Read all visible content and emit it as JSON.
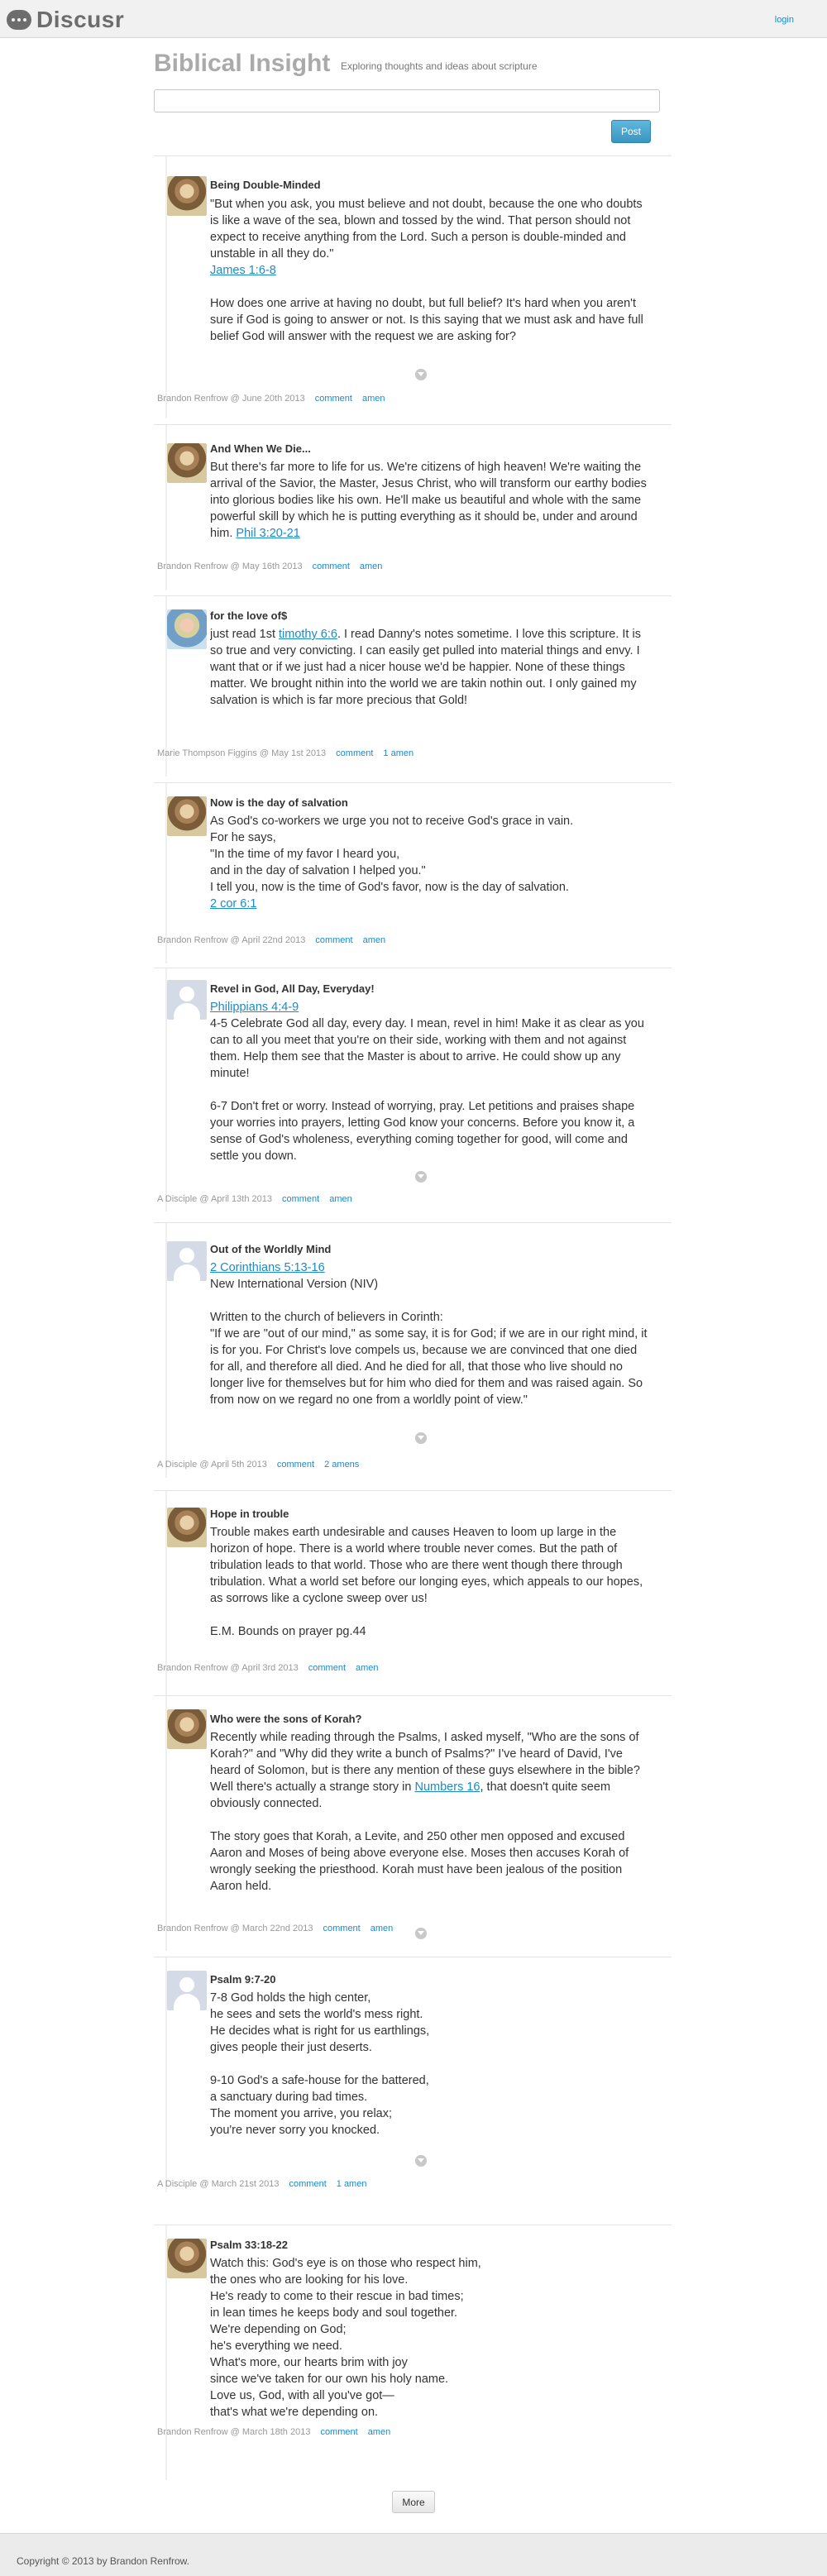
{
  "app": {
    "brand": "Discusr",
    "login": "login"
  },
  "site": {
    "title": "Biblical Insight",
    "tagline": "Exploring thoughts and ideas about scripture"
  },
  "composer": {
    "post_label": "Post"
  },
  "posts": [
    {
      "title": "Being Double-Minded",
      "paragraphs": [
        "\"But when you ask, you must believe and not doubt, because the one who doubts is like a wave of the sea, blown and tossed by the wind. That person should not expect to receive anything from the Lord. Such a person is double-minded and unstable in all they do.\"",
        "[James 1:6-8]",
        "",
        "How does one arrive at having no doubt, but full belief? It's hard when you aren't sure if God is going to answer or not. Is this saying that we must ask and have full belief God will answer with the request we are asking for?"
      ],
      "author": "Brandon Renfrow",
      "date": "June 20th 2013",
      "comment_label": "comment",
      "amen_label": "amen"
    },
    {
      "title": "And When We Die...",
      "paragraphs": [
        "But there's far more to life for us. We're citizens of high heaven! We're waiting the arrival of the Savior, the Master, Jesus Christ, who will transform our earthy bodies into glorious bodies like his own. He'll make us beautiful and whole with the same powerful skill by which he is putting everything as it should be, under and around him. [Phil 3:20-21]"
      ],
      "author": "Brandon Renfrow",
      "date": "May 16th 2013",
      "comment_label": "comment",
      "amen_label": "amen"
    },
    {
      "title": "for the love of$",
      "paragraphs": [
        "just read 1st [timothy 6:6]. I read Danny's notes sometime. I love this scripture. It is so true and very convicting. I can easily get pulled into material things and envy. I want that or if we just had a nicer house we'd be happier. None of these things matter. We brought nithin into the world we are takin nothin out. I only gained my salvation is which is far more precious that Gold!"
      ],
      "author": "Marie Thompson Figgins",
      "date": "May 1st 2013",
      "comment_label": "comment",
      "amen_label": "1 amen"
    },
    {
      "title": "Now is the day of salvation",
      "paragraphs": [
        "As God's co-workers we urge you not to receive God's grace in vain.",
        "For he says,",
        "\"In the time of my favor I heard you,",
        "and in the day of salvation I helped you.\"",
        "I tell you, now is the time of God's favor, now is the day of salvation.",
        "[2 cor 6:1]"
      ],
      "author": "Brandon Renfrow",
      "date": "April 22nd 2013",
      "comment_label": "comment",
      "amen_label": "amen"
    },
    {
      "title": "Revel in God, All Day, Everyday!",
      "paragraphs": [
        "[Philippians 4:4-9]",
        "4-5 Celebrate God all day, every day. I mean, revel in him! Make it as clear as you can to all you meet that you're on their side, working with them and not against them. Help them see that the Master is about to arrive. He could show up any minute!",
        "",
        "6-7 Don't fret or worry. Instead of worrying, pray. Let petitions and praises shape your worries into prayers, letting God know your concerns. Before you know it, a sense of God's wholeness, everything coming together for good, will come and settle you down."
      ],
      "author": "A Disciple",
      "date": "April 13th 2013",
      "comment_label": "comment",
      "amen_label": "amen"
    },
    {
      "title": "Out of the Worldly Mind",
      "paragraphs": [
        "[2 Corinthians 5:13-16]",
        "New International Version (NIV)",
        "",
        "Written to the church of believers in Corinth:",
        "\"If we are \"out of our mind,\" as some say, it is for God; if we are in our right mind, it is for you. For Christ's love compels us, because we are convinced that one died for all, and therefore all died. And he died for all, that those who live should no longer live for themselves but for him who died for them and was raised again. So from now on we regard no one from a worldly point of view.\""
      ],
      "author": "A Disciple",
      "date": "April 5th 2013",
      "comment_label": "comment",
      "amen_label": "2 amens"
    },
    {
      "title": "Hope in trouble",
      "paragraphs": [
        "Trouble makes earth undesirable and causes Heaven to loom up large in the horizon of hope. There is a world where trouble never comes. But the path of tribulation leads to that world. Those who are there went though there through tribulation. What a world set before our longing eyes, which appeals to our hopes, as sorrows like a cyclone sweep over us!",
        "",
        "E.M. Bounds on prayer pg.44"
      ],
      "author": "Brandon Renfrow",
      "date": "April 3rd 2013",
      "comment_label": "comment",
      "amen_label": "amen"
    },
    {
      "title": "Who were the sons of Korah?",
      "paragraphs": [
        "Recently while reading through the Psalms, I asked myself, \"Who are the sons of Korah?\" and \"Why did they write a bunch of Psalms?\" I've heard of David, I've heard of Solomon, but is there any mention of these guys elsewhere in the bible? Well there's actually a strange story in [Numbers 16], that doesn't quite seem obviously connected.",
        "",
        "The story goes that Korah, a Levite, and 250 other men opposed and excused Aaron and Moses of being above everyone else. Moses then accuses Korah of wrongly seeking the priesthood. Korah must have been jealous of the position Aaron held."
      ],
      "author": "Brandon Renfrow",
      "date": "March 22nd 2013",
      "comment_label": "comment",
      "amen_label": "amen"
    },
    {
      "title": "Psalm 9:7-20",
      "paragraphs": [
        "7-8 God holds the high center,",
        "he sees and sets the world's mess right.",
        "He decides what is right for us earthlings,",
        "gives people their just deserts.",
        "",
        "9-10 God's a safe-house for the battered,",
        "a sanctuary during bad times.",
        "The moment you arrive, you relax;",
        "you're never sorry you knocked."
      ],
      "author": "A Disciple",
      "date": "March 21st 2013",
      "comment_label": "comment",
      "amen_label": "1 amen"
    },
    {
      "title": "Psalm 33:18-22",
      "paragraphs": [
        "Watch this: God's eye is on those who respect him,",
        "the ones who are looking for his love.",
        "He's ready to come to their rescue in bad times;",
        "in lean times he keeps body and soul together.",
        "We're depending on God;",
        "he's everything we need.",
        "What's more, our hearts brim with joy",
        "since we've taken for our own his holy name.",
        "Love us, God, with all you've got—",
        "that's what we're depending on."
      ],
      "author": "Brandon Renfrow",
      "date": "March 18th 2013",
      "comment_label": "comment",
      "amen_label": "amen"
    }
  ],
  "pagination": {
    "more_label": "More"
  },
  "footer": {
    "copyright": "Copyright © 2013 by Brandon Renfrow."
  }
}
